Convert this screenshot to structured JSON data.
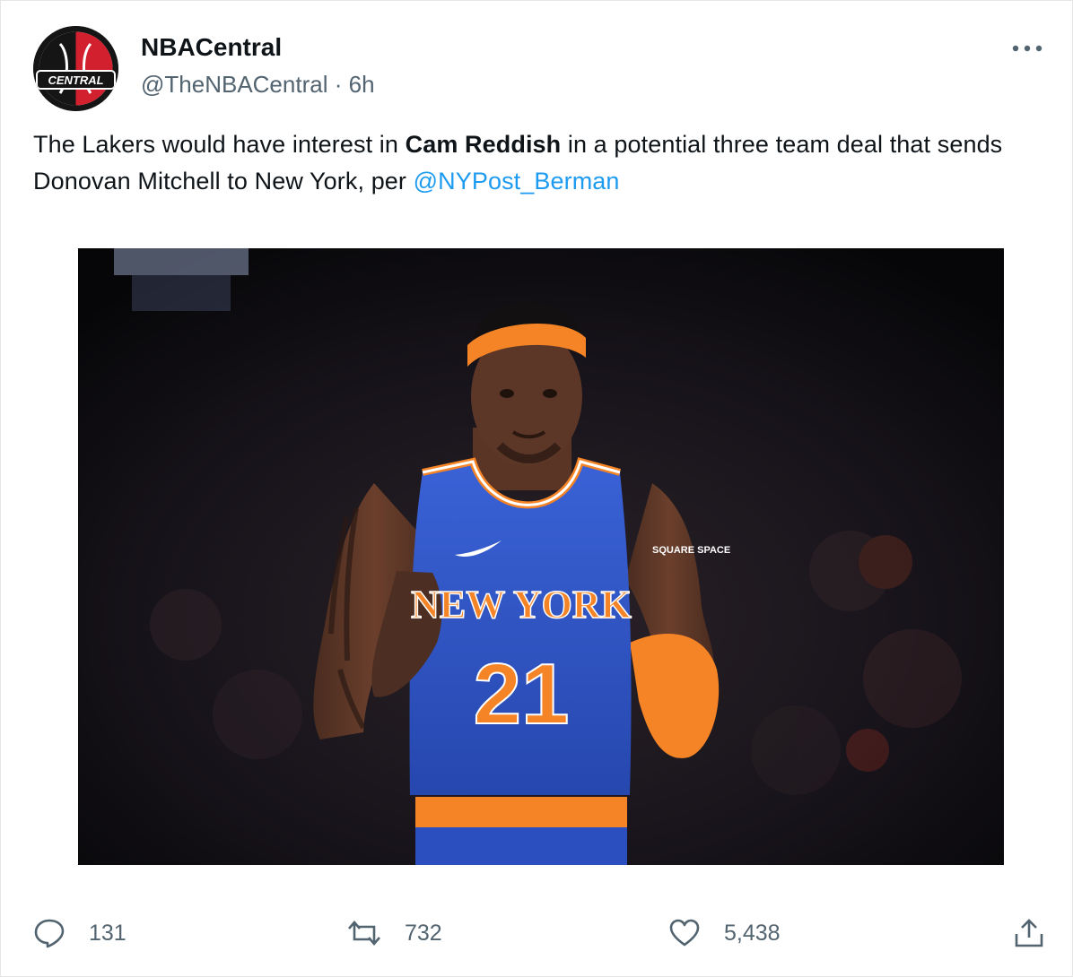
{
  "author": {
    "display_name": "NBACentral",
    "handle": "@TheNBACentral",
    "separator": "·",
    "time": "6h",
    "avatar_text": "CENTRAL"
  },
  "tweet": {
    "text_before": "The Lakers would have interest in ",
    "text_bold": "Cam Reddish",
    "text_after": " in a potential three team deal that sends Donovan Mitchell to New York, per ",
    "mention": "@NYPost_Berman"
  },
  "media": {
    "jersey_sponsor": "SQUARE SPACE",
    "jersey_team": "NEW YORK",
    "jersey_number": "21"
  },
  "actions": {
    "replies": "131",
    "retweets": "732",
    "likes": "5,438"
  },
  "icons": {
    "reply": "reply-icon",
    "retweet": "retweet-icon",
    "like": "heart-icon",
    "share": "share-icon",
    "more": "more-icon"
  },
  "colors": {
    "link": "#1d9bf0",
    "secondary_text": "#536471",
    "knicks_blue": "#2f55c8",
    "knicks_orange": "#f58426"
  }
}
